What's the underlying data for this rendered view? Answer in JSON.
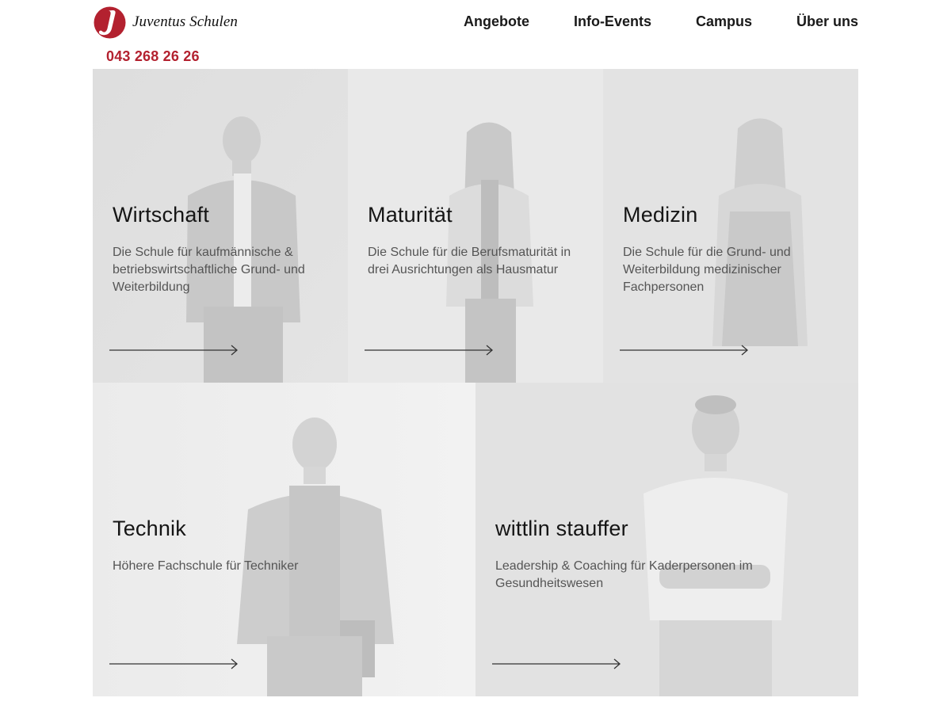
{
  "header": {
    "brand": "Juventus Schulen",
    "phone": "043 268 26 26",
    "nav": [
      {
        "label": "Angebote"
      },
      {
        "label": "Info-Events"
      },
      {
        "label": "Campus"
      },
      {
        "label": "Über uns"
      }
    ]
  },
  "colors": {
    "brand_red": "#b3212f",
    "text": "#1a1a1a",
    "muted": "#555555",
    "tile_bg": "#e8e8e8"
  },
  "tiles": [
    {
      "title": "Wirtschaft",
      "desc": [
        "Die Schule für kaufmännische &",
        "betriebswirtschaftliche Grund- und",
        "Weiterbildung"
      ]
    },
    {
      "title": "Maturität",
      "desc": [
        "Die Schule für die Berufsmaturität in",
        "drei Ausrichtungen als Hausmatur"
      ]
    },
    {
      "title": "Medizin",
      "desc": [
        "Die Schule für die Grund- und",
        "Weiterbildung medizinischer",
        "Fachpersonen"
      ]
    },
    {
      "title": "Technik",
      "desc": [
        "Höhere Fachschule für Techniker"
      ]
    },
    {
      "title": "wittlin stauffer",
      "desc": [
        "Leadership & Coaching für Kaderpersonen im",
        "Gesundheitswesen"
      ]
    }
  ],
  "icons": {
    "logo": "juventus-logo-icon",
    "arrow": "arrow-right-icon",
    "person": "person-photo"
  }
}
